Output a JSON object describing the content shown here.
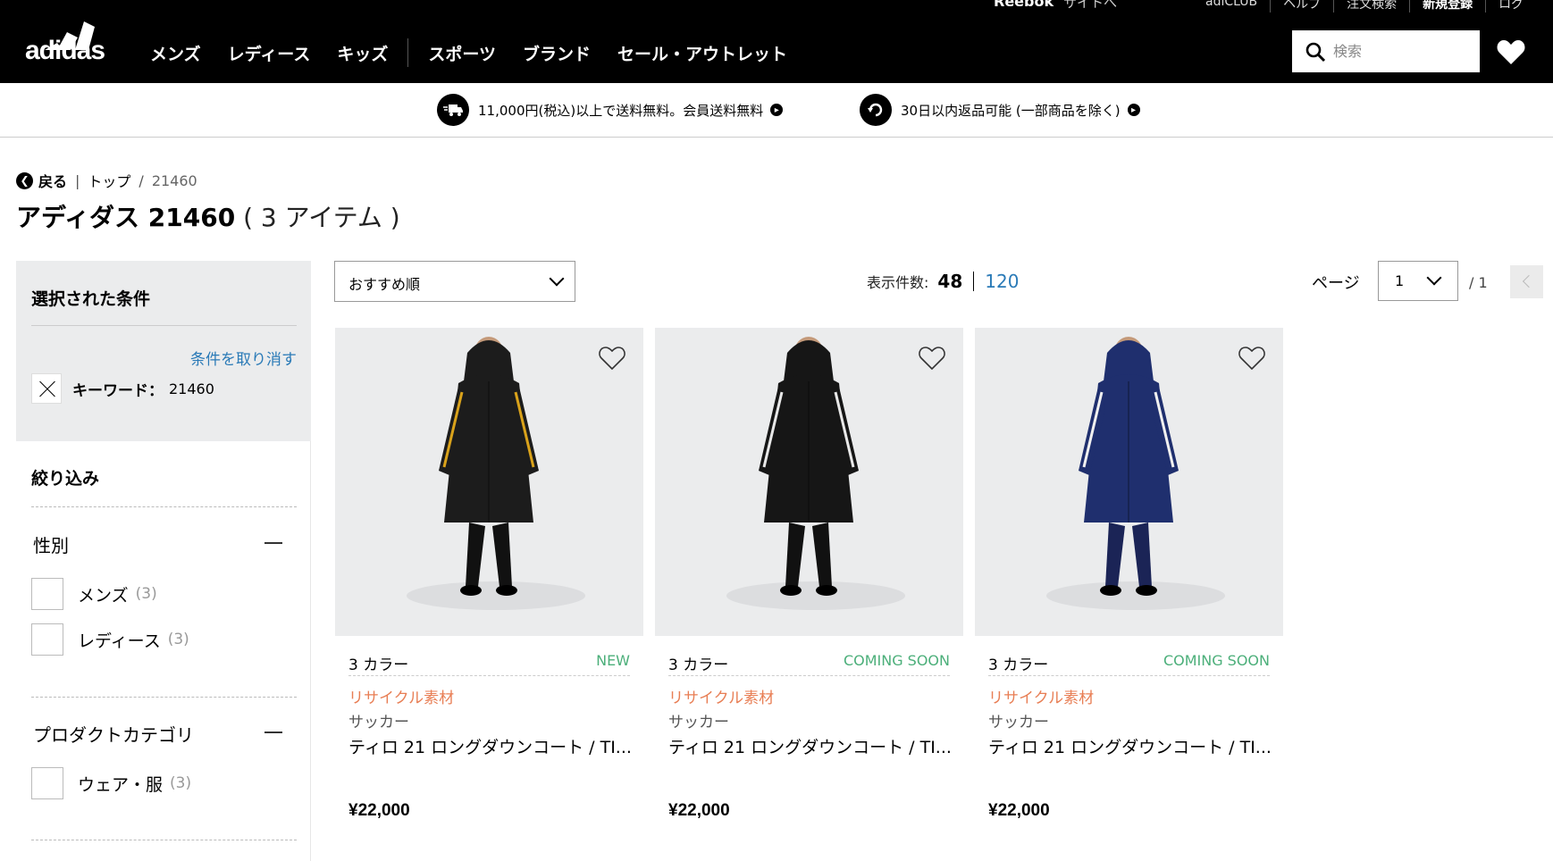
{
  "utility": {
    "reebok": "Reebok",
    "reebok_site": "サイトへ",
    "links": [
      "adiCLUB",
      "ヘルプ",
      "注文検索",
      "新規登録",
      "ログ"
    ]
  },
  "nav": {
    "logo_text": "adidas",
    "items": [
      "メンズ",
      "レディース",
      "キッズ"
    ],
    "items2": [
      "スポーツ",
      "ブランド",
      "セール・アウトレット"
    ],
    "search_placeholder": "検索"
  },
  "promo": {
    "shipping": "11,000円(税込)以上で送料無料。会員送料無料",
    "returns": "30日以内返品可能 (一部商品を除く)"
  },
  "breadcrumb": {
    "back": "戻る",
    "top": "トップ",
    "current": "21460"
  },
  "title": {
    "main": "アディダス 21460",
    "count": "( 3 アイテム )"
  },
  "selected": {
    "heading": "選択された条件",
    "clear": "条件を取り消す",
    "keyword_label": "キーワード：",
    "keyword_value": "21460"
  },
  "refine": {
    "heading": "絞り込み",
    "gender": {
      "title": "性別",
      "options": [
        {
          "label": "メンズ",
          "count": "(3)"
        },
        {
          "label": "レディース",
          "count": "(3)"
        }
      ]
    },
    "category": {
      "title": "プロダクトカテゴリ",
      "options": [
        {
          "label": "ウェア・服",
          "count": "(3)"
        }
      ]
    }
  },
  "toolbar": {
    "sort_value": "おすすめ順",
    "per_page_label": "表示件数:",
    "per_page_current": "48",
    "per_page_alt": "120",
    "page_label": "ページ",
    "page_value": "1",
    "page_total": "/ 1"
  },
  "products": [
    {
      "colors": "3 カラー",
      "badge": "NEW",
      "material": "リサイクル素材",
      "sport": "サッカー",
      "name": "ティロ 21 ロングダウンコート / TI...",
      "price": "¥22,000",
      "coat_color": "#1c1c1c",
      "accent_color": "#d9a21b",
      "pants_color": "#111111"
    },
    {
      "colors": "3 カラー",
      "badge": "COMING SOON",
      "material": "リサイクル素材",
      "sport": "サッカー",
      "name": "ティロ 21 ロングダウンコート / TI...",
      "price": "¥22,000",
      "coat_color": "#161616",
      "accent_color": "#e8e8e8",
      "pants_color": "#111111"
    },
    {
      "colors": "3 カラー",
      "badge": "COMING SOON",
      "material": "リサイクル素材",
      "sport": "サッカー",
      "name": "ティロ 21 ロングダウンコート / TI...",
      "price": "¥22,000",
      "coat_color": "#1f2f6e",
      "accent_color": "#f0f0f0",
      "pants_color": "#1b2456"
    }
  ],
  "colors": {
    "link_blue": "#2a7ab7",
    "badge_green": "#4caf7a",
    "recycle_orange": "#e87e54",
    "panel_gray": "#ebeced"
  }
}
